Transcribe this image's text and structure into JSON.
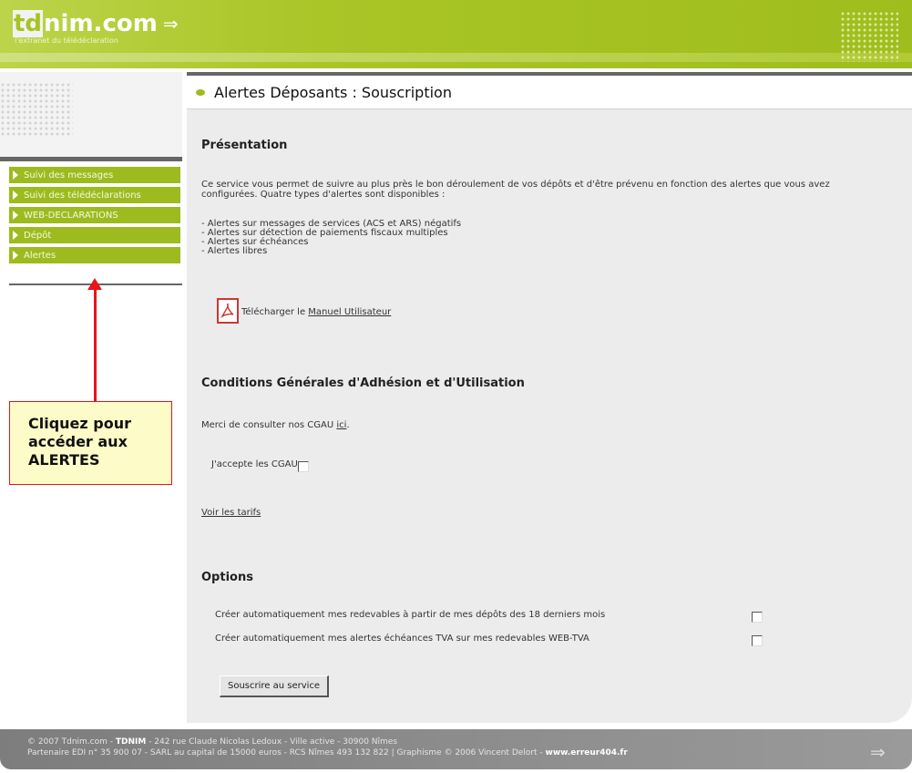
{
  "header": {
    "logo_td": "td",
    "logo_rest": "nim.com",
    "logo_arrows": "⇒",
    "tagline": "l'extranet du télédéclaration"
  },
  "nav": {
    "items": [
      {
        "label": "Suivi des messages"
      },
      {
        "label": "Suivi des télédéclarations"
      },
      {
        "label": "WEB-DECLARATIONS"
      },
      {
        "label": "Dépôt"
      },
      {
        "label": "Alertes"
      }
    ]
  },
  "page": {
    "title": "Alertes Déposants : Souscription"
  },
  "presentation": {
    "heading": "Présentation",
    "paragraph": "Ce service vous permet de suivre au plus près le bon déroulement de vos dépôts et d'être prévenu en fonction des alertes que vous avez configurées. Quatre types d'alertes sont disponibles :",
    "list": [
      "- Alertes sur messages de services (ACS et ARS) négatifs",
      "- Alertes sur détection de paiements fiscaux multiples",
      "- Alertes sur échéances",
      "- Alertes libres"
    ],
    "download_prefix": "Télécharger le ",
    "download_link": "Manuel Utilisateur"
  },
  "conditions": {
    "heading": "Conditions Générales d'Adhésion et d'Utilisation",
    "text_prefix": "Merci de consulter nos CGAU ",
    "text_link": "ici",
    "text_suffix": ".",
    "accept_label": "J'accepte les CGAU",
    "accept_checked": false,
    "tarifs_link": "Voir les tarifs"
  },
  "options": {
    "heading": "Options",
    "items": [
      {
        "label": "Créer automatiquement mes redevables à partir de mes dépôts des 18 derniers mois",
        "checked": false
      },
      {
        "label": "Créer automatiquement mes alertes échéances TVA sur mes redevables WEB-TVA",
        "checked": false
      }
    ],
    "submit_label": "Souscrire au service"
  },
  "callout": {
    "line1": "Cliquez pour",
    "line2": "accéder aux",
    "line3": "ALERTES"
  },
  "footer": {
    "line1_prefix": "© 2007 Tdnim.com - ",
    "line1_bold": "TDNIM",
    "line1_rest": " - 242 rue Claude Nicolas Ledoux - Ville active - 30900 Nîmes",
    "line2_prefix": "Partenaire EDI n° 35 900 07 - SARL au capital de 15000 euros - RCS Nîmes 493 132 822 | Graphisme © 2006 Vincent Delort - ",
    "line2_bold": "www.erreur404.fr"
  },
  "colors": {
    "brand_green": "#9dbb1e",
    "callout_bg": "#fdfcc9",
    "annotation_red": "#e8141b"
  }
}
